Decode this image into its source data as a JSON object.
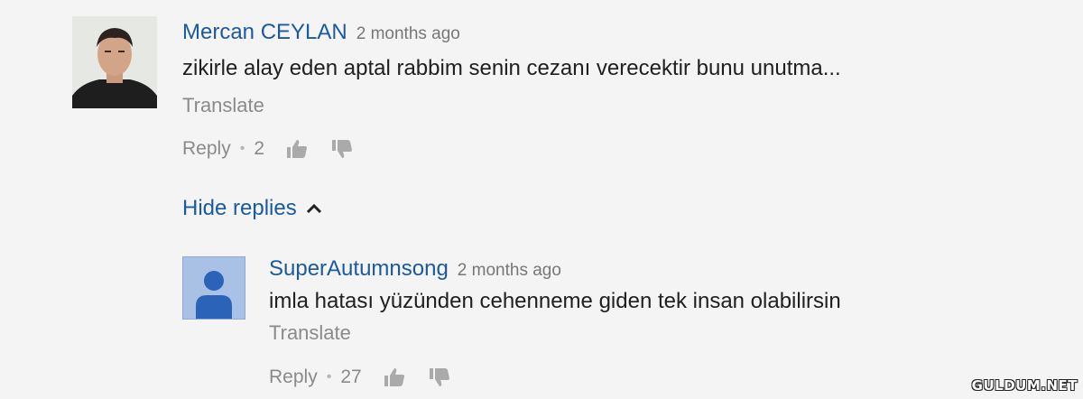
{
  "comments": [
    {
      "author": "Mercan CEYLAN",
      "time": "2 months ago",
      "text": "zikirle alay eden aptal rabbim senin cezanı verecektir bunu unutma...",
      "translate": "Translate",
      "reply": "Reply",
      "likes": "2",
      "avatar": "photo-avatar"
    }
  ],
  "hide_replies": "Hide replies",
  "replies": [
    {
      "author": "SuperAutumnsong",
      "time": "2 months ago",
      "text": "imla hatası yüzünden cehenneme giden tek insan olabilirsin",
      "translate": "Translate",
      "reply": "Reply",
      "likes": "27",
      "avatar": "default-user-avatar"
    }
  ],
  "watermark": "GULDUM.NET",
  "colors": {
    "author": "#1b5aa0",
    "text": "#202020",
    "meta": "#8a8a8a",
    "background": "#f4f4f4"
  }
}
